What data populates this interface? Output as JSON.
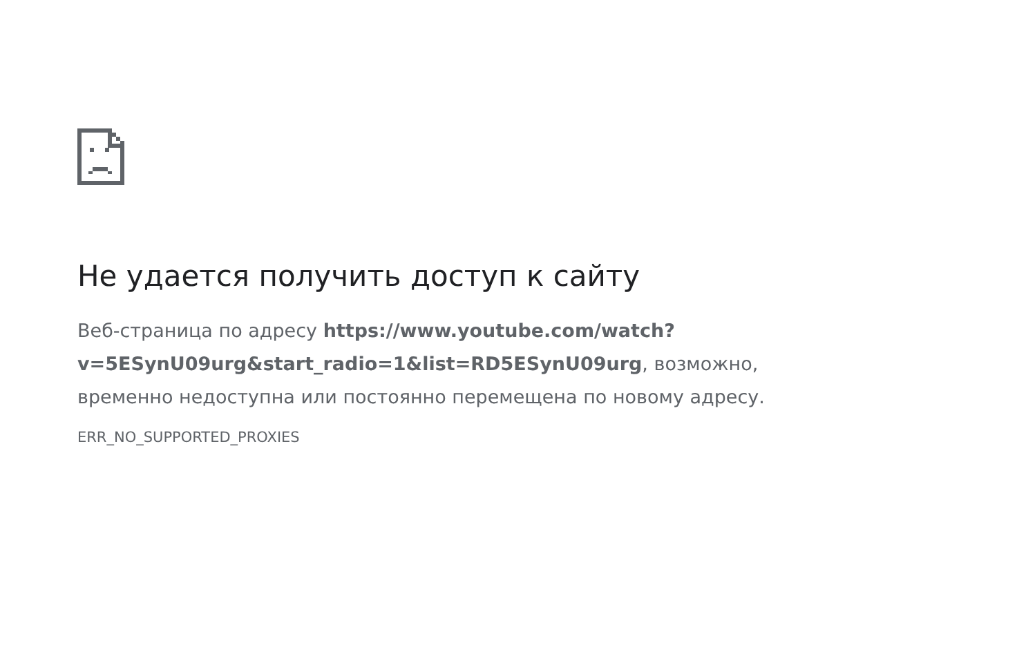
{
  "heading": "Не удается получить доступ к сайту",
  "message": "Веб-страница по адресу **https://www.youtube.com/watch?v=5ESynU09urg&start_radio=1&list=RD5ESynU09urg**, возможно, временно недоступна или постоянно перемещена по новому адресу.",
  "error_code": "ERR_NO_SUPPORTED_PROXIES"
}
